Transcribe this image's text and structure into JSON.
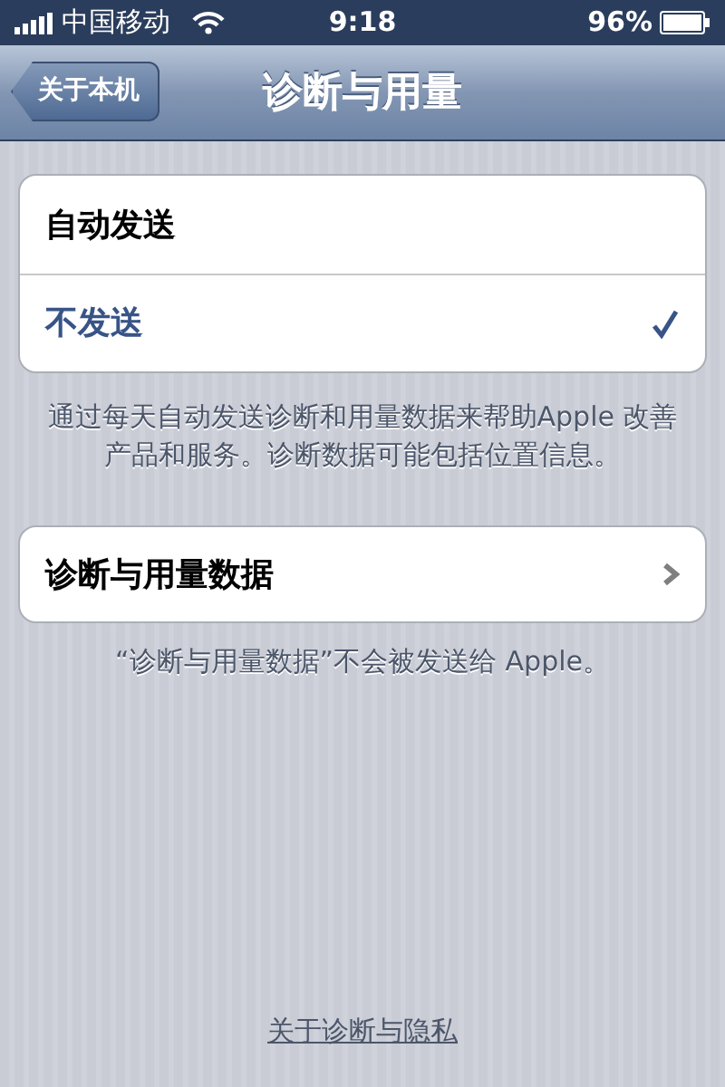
{
  "status_bar": {
    "carrier": "中国移动",
    "time": "9:18",
    "battery": "96%"
  },
  "nav_bar": {
    "back": "关于本机",
    "title": "诊断与用量"
  },
  "options": [
    {
      "label": "自动发送",
      "selected": false
    },
    {
      "label": "不发送",
      "selected": true
    }
  ],
  "options_footer": "通过每天自动发送诊断和用量数据来帮助Apple 改善产品和服务。诊断数据可能包括位置信息。",
  "data_row": {
    "label": "诊断与用量数据"
  },
  "data_footer": "“诊断与用量数据”不会被发送给 Apple。",
  "privacy_link": "关于诊断与隐私"
}
